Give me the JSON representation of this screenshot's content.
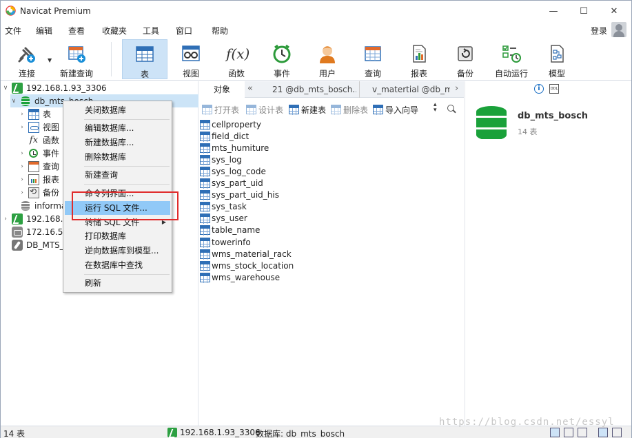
{
  "window": {
    "title": "Navicat Premium",
    "min": "—",
    "max": "☐",
    "close": "✕"
  },
  "menu": [
    "文件",
    "编辑",
    "查看",
    "收藏夹",
    "工具",
    "窗口",
    "帮助"
  ],
  "login": "登录",
  "toolbar": [
    {
      "label": "连接",
      "icon": "plug-icon"
    },
    {
      "label": "新建查询",
      "icon": "new-query-icon"
    },
    {
      "label": "表",
      "icon": "table-icon",
      "active": true
    },
    {
      "label": "视图",
      "icon": "view-icon"
    },
    {
      "label": "函数",
      "icon": "function-icon",
      "glyph": "f(x)"
    },
    {
      "label": "事件",
      "icon": "clock-icon"
    },
    {
      "label": "用户",
      "icon": "user-icon"
    },
    {
      "label": "查询",
      "icon": "query-icon"
    },
    {
      "label": "报表",
      "icon": "report-icon"
    },
    {
      "label": "备份",
      "icon": "backup-icon"
    },
    {
      "label": "自动运行",
      "icon": "automation-icon"
    },
    {
      "label": "模型",
      "icon": "model-icon"
    }
  ],
  "tree": {
    "conn1": "192.168.1.93_3306",
    "db": "db_mts_bosch",
    "children": [
      "表",
      "视图",
      "函数",
      "事件",
      "查询",
      "报表",
      "备份"
    ],
    "info_schema": "informa",
    "conn2": "192.168.1",
    "conn3": "172.16.50",
    "conn4": "DB_MTS_"
  },
  "context_menu": {
    "items": [
      "关闭数据库",
      "编辑数据库...",
      "新建数据库...",
      "删除数据库",
      "新建查询",
      "命令列界面...",
      "运行 SQL 文件...",
      "转储 SQL 文件",
      "打印数据库",
      "逆向数据库到模型...",
      "在数据库中查找",
      "刷新"
    ],
    "highlighted": "运行 SQL 文件...",
    "submenu_arrow": "▶"
  },
  "tabs": {
    "objects": "对象",
    "tab1": "21 @db_mts_bosch...",
    "tab2": "v_matertial @db_m..."
  },
  "object_toolbar": {
    "open": "打开表",
    "design": "设计表",
    "new": "新建表",
    "delete": "删除表",
    "import": "导入向导"
  },
  "tables": [
    "cellproperty",
    "field_dict",
    "mts_humiture",
    "sys_log",
    "sys_log_code",
    "sys_part_uid",
    "sys_part_uid_his",
    "sys_task",
    "sys_user",
    "table_name",
    "towerinfo",
    "wms_material_rack",
    "wms_stock_location",
    "wms_warehouse"
  ],
  "info_panel": {
    "db_name": "db_mts_bosch",
    "count": "14 表",
    "info_glyph": "i",
    "ddl_glyph": "DDL"
  },
  "status": {
    "count": "14 表",
    "connection": "192.168.1.93_3306",
    "database": "数据库: db_mts_bosch"
  },
  "watermark": "https://blog.csdn.net/essyl",
  "colors": {
    "accent": "#cde3f7",
    "highlight": "#91c9f7",
    "annotation": "#e02b2b",
    "db_green": "#1aa13a"
  }
}
